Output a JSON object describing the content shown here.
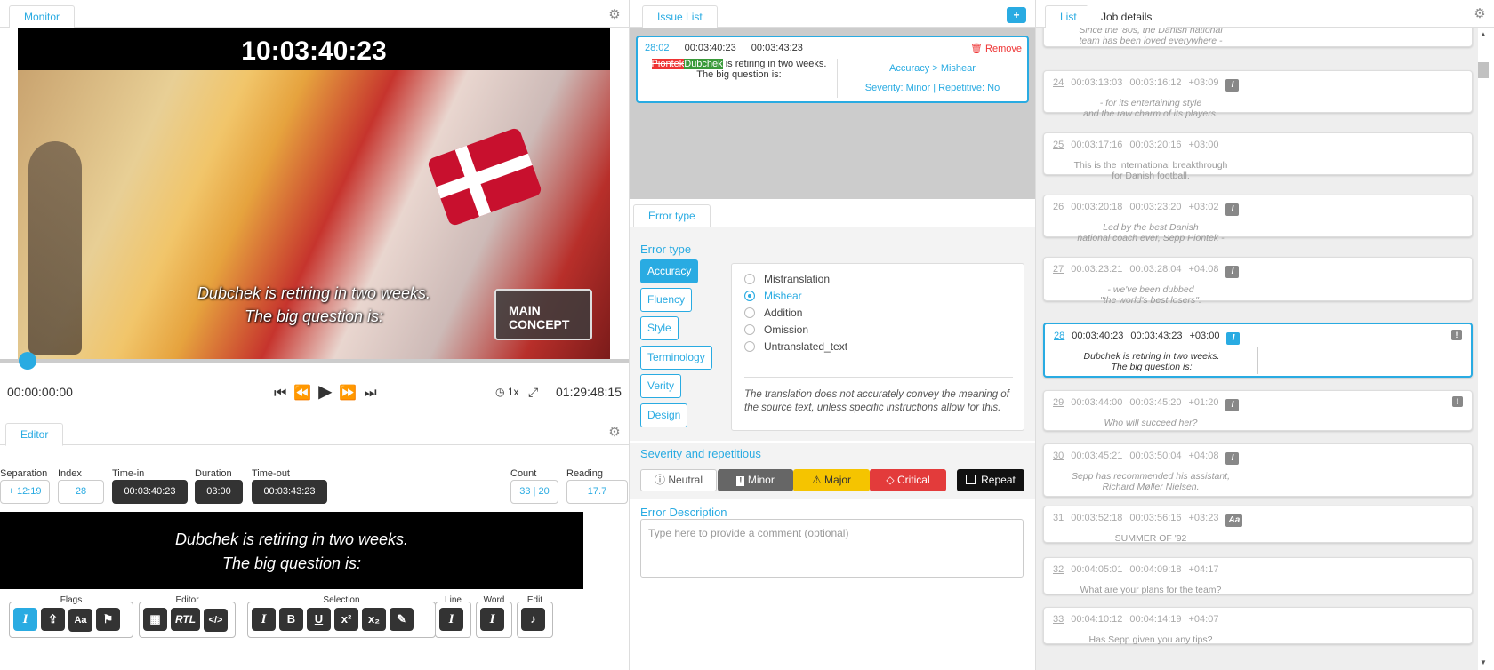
{
  "monitor": {
    "tab": "Monitor",
    "timecode": "10:03:40:23",
    "subtitle_lines": [
      "Dubchek is retiring in two weeks.",
      "The big question is:"
    ],
    "logo_text": "MAIN CONCEPT",
    "time_current": "00:00:00:00",
    "speed": "1x",
    "time_total": "01:29:48:15"
  },
  "editor": {
    "tab": "Editor",
    "fields": {
      "separation_label": "Separation",
      "separation": "+ 12:19",
      "index_label": "Index",
      "index": "28",
      "timein_label": "Time-in",
      "timein": "00:03:40:23",
      "duration_label": "Duration",
      "duration": "03:00",
      "timeout_label": "Time-out",
      "timeout": "00:03:43:23",
      "count_label": "Count",
      "count_a": "33",
      "count_b": "20",
      "reading_label": "Reading Speed",
      "reading": "17.7"
    },
    "subtitle": {
      "error_word": "Dubchek",
      "line1_rest": " is retiring in two weeks.",
      "line2": "The big question is:"
    },
    "groups": {
      "flags": "Flags",
      "editor": "Editor",
      "selection": "Selection",
      "line": "Line",
      "word": "Word",
      "edit": "Edit"
    },
    "buttons": {
      "rtl": "RTL",
      "code": "</>",
      "bold": "B",
      "underline": "U",
      "sup": "x²",
      "sub": "x₂",
      "aa": "Aa",
      "italic": "I"
    }
  },
  "issues": {
    "tab": "Issue List",
    "card": {
      "link": "28:02",
      "time_in": "00:03:40:23",
      "time_out": "00:03:43:23",
      "remove": "Remove",
      "deleted": "Piontek",
      "inserted": "Dubchek",
      "rest1": " is retiring in two weeks.",
      "line2": "The big question is:",
      "category": "Accuracy > Mishear",
      "severity": "Severity: Minor | Repetitive: No"
    }
  },
  "error_type": {
    "tab": "Error type",
    "heading": "Error type",
    "categories": [
      "Accuracy",
      "Fluency",
      "Style",
      "Terminology",
      "Verity",
      "Design"
    ],
    "options": [
      "Mistranslation",
      "Mishear",
      "Addition",
      "Omission",
      "Untranslated_text"
    ],
    "selected_option": "Mishear",
    "description": "The translation does not accurately convey the meaning of the source text, unless specific instructions allow for this."
  },
  "severity": {
    "heading": "Severity and repetitious",
    "neutral": "Neutral",
    "minor": "Minor",
    "major": "Major",
    "critical": "Critical",
    "repeat": "Repeat"
  },
  "error_description": {
    "heading": "Error Description",
    "placeholder": "Type here to provide a comment (optional)"
  },
  "right": {
    "tabs": [
      "List",
      "Job details"
    ],
    "items": [
      {
        "idx": "",
        "tin": "",
        "tout": "",
        "dur": "",
        "badge": "I",
        "lines": [
          "Since the '80s, the Danish national",
          "team has been loved everywhere -"
        ]
      },
      {
        "idx": "24",
        "tin": "00:03:13:03",
        "tout": "00:03:16:12",
        "dur": "+03:09",
        "badge": "I",
        "lines": [
          "- for its entertaining style",
          "and the raw charm of its players."
        ]
      },
      {
        "idx": "25",
        "tin": "00:03:17:16",
        "tout": "00:03:20:16",
        "dur": "+03:00",
        "badge": "",
        "lines": [
          "This is the international breakthrough",
          "for Danish football."
        ]
      },
      {
        "idx": "26",
        "tin": "00:03:20:18",
        "tout": "00:03:23:20",
        "dur": "+03:02",
        "badge": "I",
        "lines": [
          "Led by the best Danish",
          "national coach ever, Sepp Piontek -"
        ]
      },
      {
        "idx": "27",
        "tin": "00:03:23:21",
        "tout": "00:03:28:04",
        "dur": "+04:08",
        "badge": "I",
        "lines": [
          "- we've been dubbed",
          "\"the world's best losers\"."
        ]
      },
      {
        "idx": "28",
        "tin": "00:03:40:23",
        "tout": "00:03:43:23",
        "dur": "+03:00",
        "badge": "I",
        "lines": [
          "Dubchek is retiring in two weeks.",
          "The big question is:"
        ]
      },
      {
        "idx": "29",
        "tin": "00:03:44:00",
        "tout": "00:03:45:20",
        "dur": "+01:20",
        "badge": "I",
        "lines": [
          "Who will succeed her?"
        ]
      },
      {
        "idx": "30",
        "tin": "00:03:45:21",
        "tout": "00:03:50:04",
        "dur": "+04:08",
        "badge": "I",
        "lines": [
          "Sepp has recommended his assistant,",
          "Richard Møller Nielsen."
        ]
      },
      {
        "idx": "31",
        "tin": "00:03:52:18",
        "tout": "00:03:56:16",
        "dur": "+03:23",
        "badge": "Aa",
        "lines": [
          "SUMMER OF '92"
        ]
      },
      {
        "idx": "32",
        "tin": "00:04:05:01",
        "tout": "00:04:09:18",
        "dur": "+04:17",
        "badge": "",
        "lines": [
          "What are your plans for the team?"
        ]
      },
      {
        "idx": "33",
        "tin": "00:04:10:12",
        "tout": "00:04:14:19",
        "dur": "+04:07",
        "badge": "",
        "lines": [
          "Has Sepp given you any tips?"
        ]
      }
    ]
  },
  "colors": {
    "accent": "#29abe2",
    "critical": "#e33b3b",
    "major": "#f5c400",
    "minor": "#666666"
  }
}
